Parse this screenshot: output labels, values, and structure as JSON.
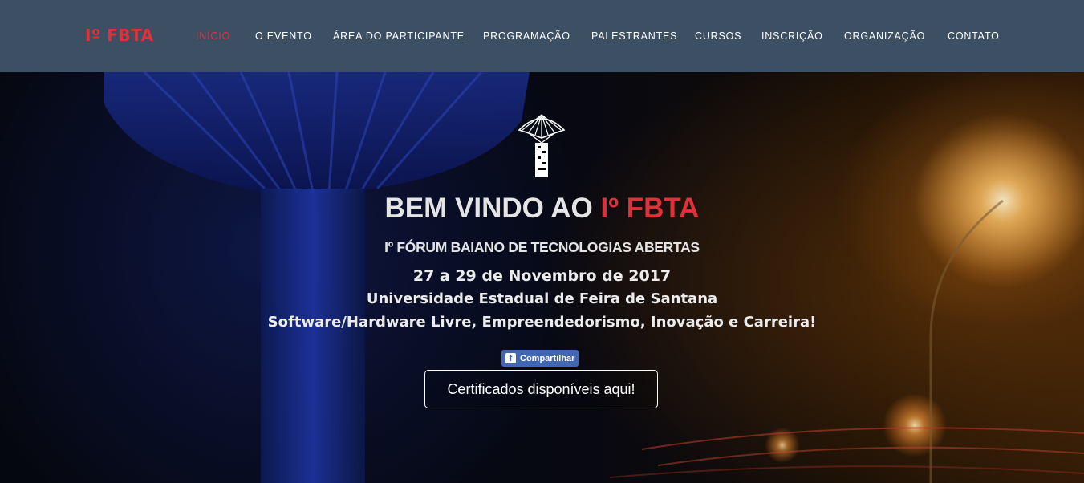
{
  "brand": "Iº FBTA",
  "nav": {
    "items": [
      {
        "label": "INÍCIO",
        "active": true
      },
      {
        "label": "O EVENTO"
      },
      {
        "label": "ÁREA DO PARTICIPANTE"
      },
      {
        "label": "PROGRAMAÇÃO"
      },
      {
        "label": "PALESTRANTES"
      },
      {
        "label": "CURSOS"
      },
      {
        "label": "INSCRIÇÃO"
      },
      {
        "label": "ORGANIZAÇÃO"
      },
      {
        "label": "CONTATO"
      }
    ]
  },
  "hero": {
    "title_prefix": "BEM VINDO AO ",
    "title_accent": "Iº FBTA",
    "subtitle": "Iº FÓRUM BAIANO DE TECNOLOGIAS ABERTAS",
    "dates": "27 a 29 de Novembro de 2017",
    "venue": "Universidade Estadual de Feira de Santana",
    "topics": "Software/Hardware Livre, Empreendedorismo, Inovação e Carreira!",
    "share_label": "Compartilhar",
    "cert_label": "Certificados disponíveis aqui!"
  },
  "colors": {
    "navbar_bg": "#3d4f63",
    "accent": "#e0313b",
    "facebook": "#4267b2"
  },
  "icons": {
    "hero_logo": "water-tower-logo-icon",
    "share": "facebook-icon"
  }
}
